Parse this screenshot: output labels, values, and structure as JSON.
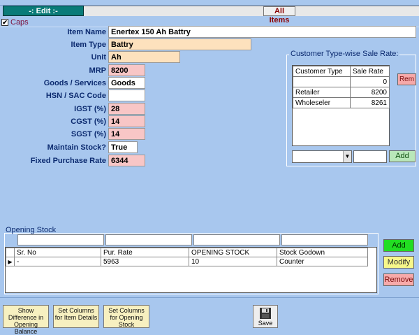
{
  "header": {
    "edit_title": "-: Edit :-",
    "all_items": "All Items"
  },
  "caps": {
    "label": "Caps",
    "checked": "✔"
  },
  "form": {
    "item_name": {
      "label": "Item Name",
      "value": "Enertex 150 Ah Battry"
    },
    "item_type": {
      "label": "Item Type",
      "value": "Battry"
    },
    "unit": {
      "label": "Unit",
      "value": "Ah"
    },
    "mrp": {
      "label": "MRP",
      "value": "8200"
    },
    "goods_services": {
      "label": "Goods / Services",
      "value": "Goods"
    },
    "hsn_sac": {
      "label": "HSN / SAC Code",
      "value": ""
    },
    "igst": {
      "label": "IGST (%)",
      "value": "28"
    },
    "cgst": {
      "label": "CGST (%)",
      "value": "14"
    },
    "sgst": {
      "label": "SGST (%)",
      "value": "14"
    },
    "maintain_stock": {
      "label": "Maintain Stock?",
      "value": "True"
    },
    "fixed_purchase_rate": {
      "label": "Fixed Purchase Rate",
      "value": "6344"
    }
  },
  "customer_rates": {
    "title": "Customer Type-wise Sale Rate:",
    "columns": [
      "Customer Type",
      "Sale Rate"
    ],
    "rows": [
      {
        "type": "",
        "rate": "0"
      },
      {
        "type": "Retailer",
        "rate": "8200"
      },
      {
        "type": "Wholeseler",
        "rate": "8261"
      }
    ],
    "rem_label": "Rem",
    "add_label": "Add",
    "combo_value": "",
    "rate_value": "",
    "arrow": "▼"
  },
  "opening_stock": {
    "title": "Opening Stock",
    "columns": [
      "Sr. No",
      "Pur. Rate",
      "OPENING STOCK",
      "Stock Godown"
    ],
    "row": {
      "indicator": "▶",
      "sr": "-",
      "pur_rate": "5963",
      "stock": "10",
      "godown": "Counter"
    },
    "add_label": "Add",
    "modify_label": "Modify",
    "remove_label": "Remove"
  },
  "footer": {
    "btn1": "Show Difference in Opening Balance",
    "btn2": "Set Columns for Item Details",
    "btn3": "Set Columns for Opening Stock",
    "save": "Save"
  }
}
